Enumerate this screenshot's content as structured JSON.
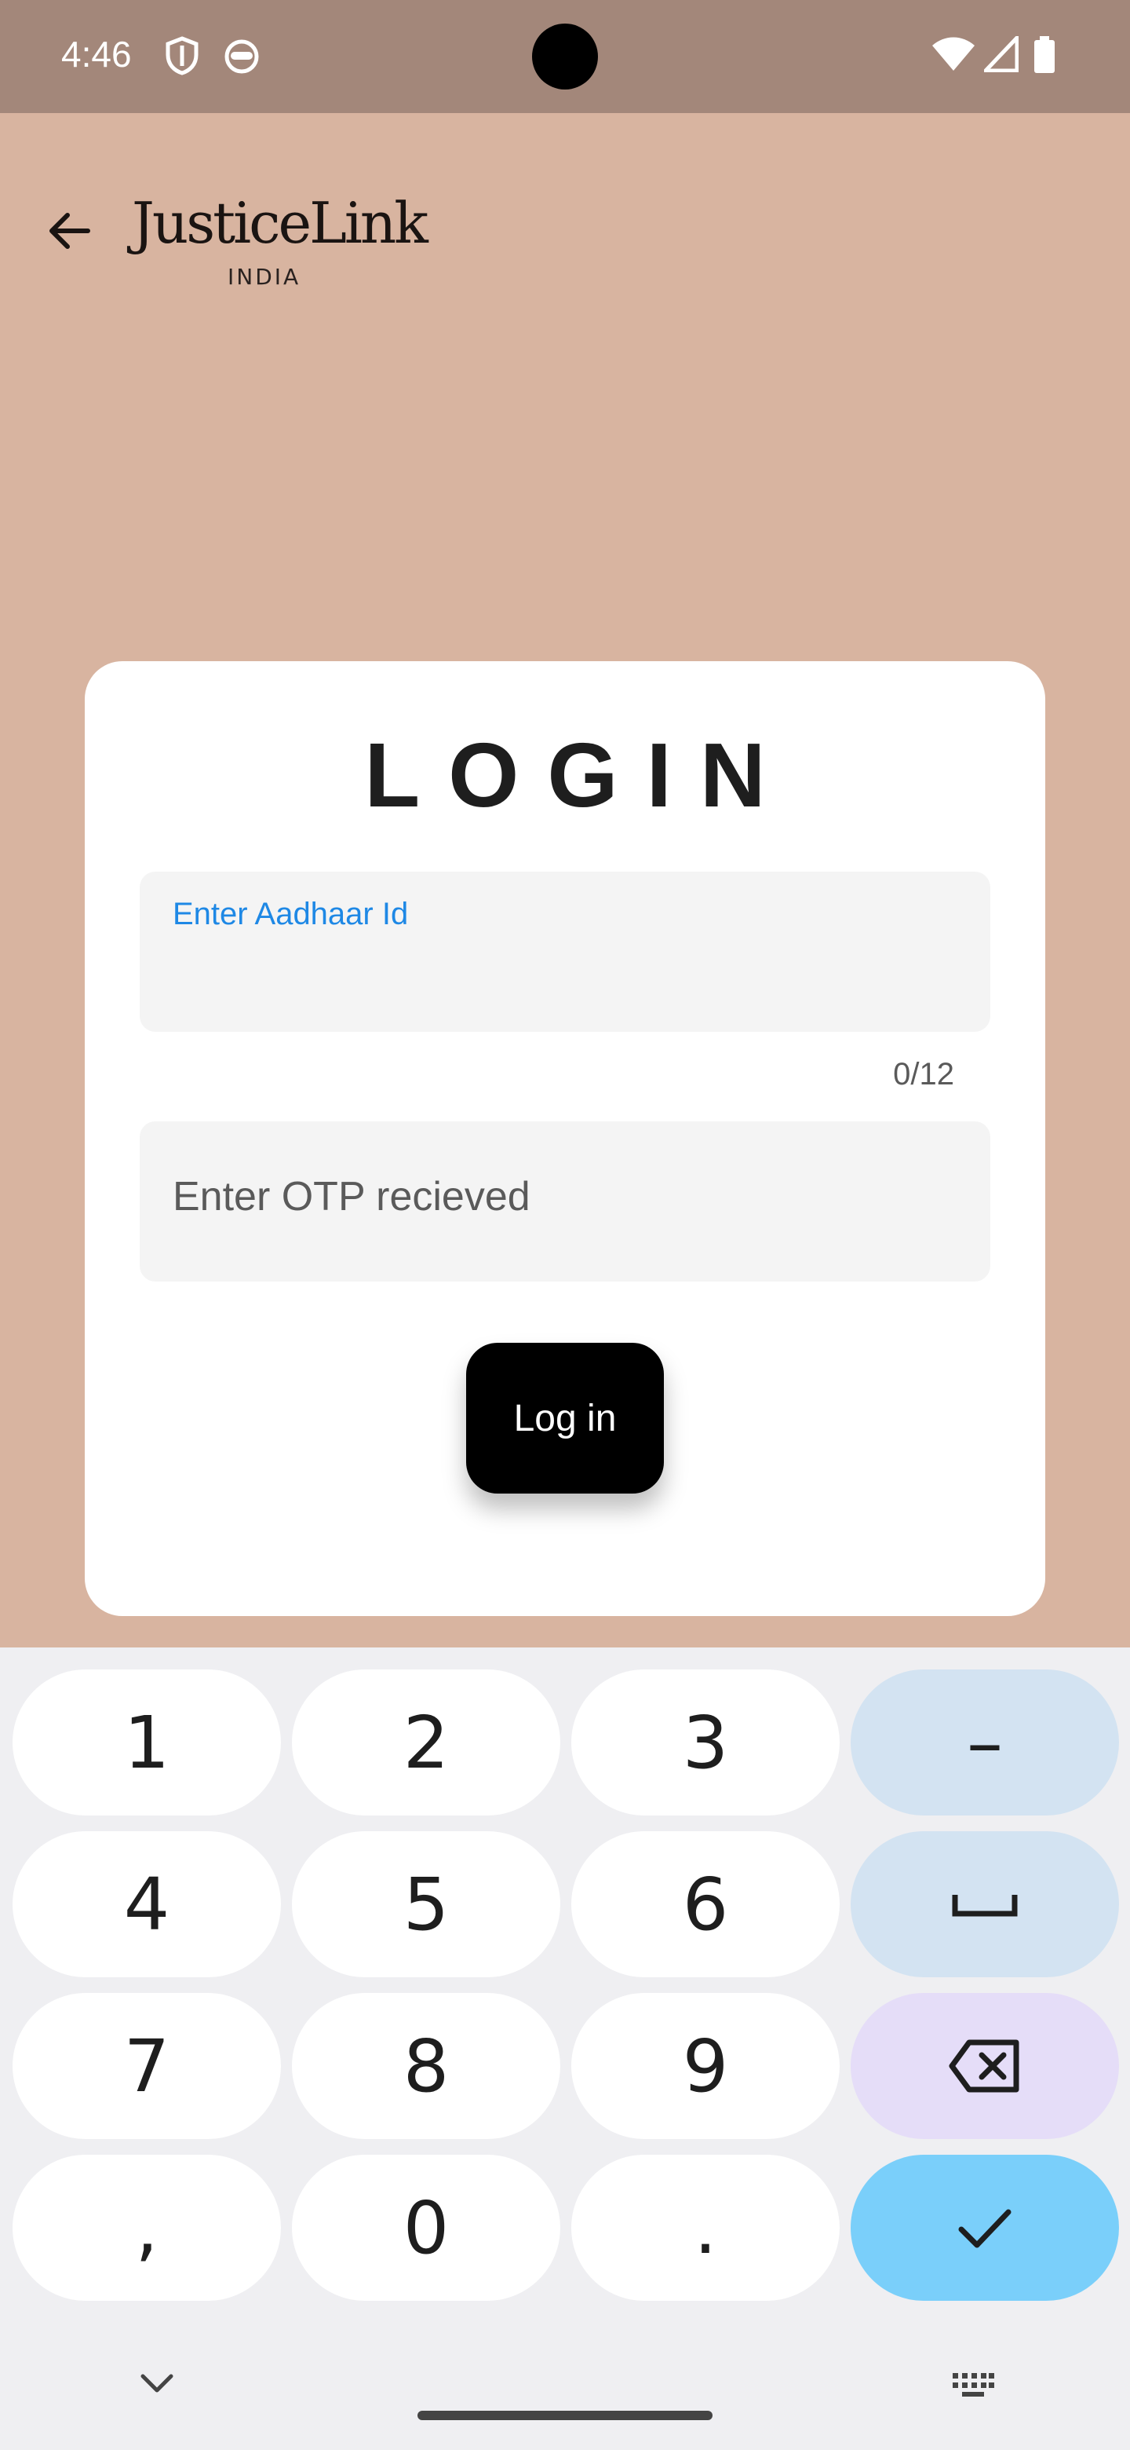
{
  "status_bar": {
    "time": "4:46",
    "left_icons": [
      "shield-icon",
      "face-icon"
    ],
    "right_icons": [
      "wifi-icon",
      "signal-icon",
      "battery-icon"
    ]
  },
  "header": {
    "logo_main": "JusticeLink",
    "logo_sub": "INDIA"
  },
  "login_card": {
    "title": "LOGIN",
    "aadhaar_field": {
      "label": "Enter Aadhaar Id",
      "value": "",
      "counter": "0/12"
    },
    "otp_field": {
      "placeholder": "Enter OTP recieved",
      "value": ""
    },
    "login_button": "Log in"
  },
  "keyboard": {
    "rows": [
      [
        "1",
        "2",
        "3",
        "–"
      ],
      [
        "4",
        "5",
        "6",
        "␣"
      ],
      [
        "7",
        "8",
        "9",
        "⌫"
      ],
      [
        ",",
        "0",
        ".",
        "✓"
      ]
    ]
  },
  "colors": {
    "background": "#D8B4A0",
    "status_bar": "#A3877A",
    "accent_label": "#1E88E5",
    "done_key": "#7ACFFA"
  }
}
